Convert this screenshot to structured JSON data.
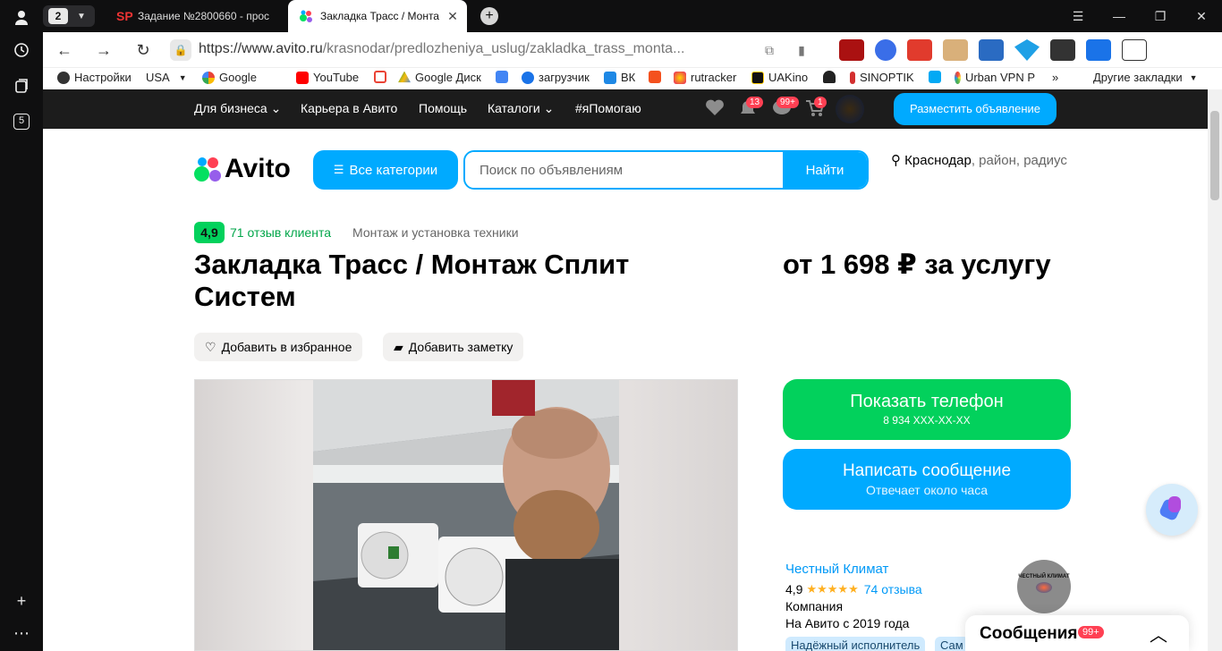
{
  "browser": {
    "tab_count": "2",
    "tabs": [
      {
        "title": "Задание №2800660 - прос"
      },
      {
        "title": "Закладка Трасс / Монта"
      }
    ],
    "url_host": "https://www.avito.ru",
    "url_path": "/krasnodar/predlozheniya_uslug/zakladka_trass_monta...",
    "leftbar_badge": "5"
  },
  "bookmarks": [
    {
      "label": "Настройки"
    },
    {
      "label": "USA"
    },
    {
      "label": "Google"
    },
    {
      "label": "YouTube"
    },
    {
      "label": "Google Диск"
    },
    {
      "label": "загрузчик"
    },
    {
      "label": "ВК"
    },
    {
      "label": "rutracker"
    },
    {
      "label": "UAKino"
    },
    {
      "label": "SINOPTIK"
    },
    {
      "label": "Urban VPN P"
    },
    {
      "label": "Другие закладки"
    }
  ],
  "avito_top": {
    "business": "Для бизнеса",
    "career": "Карьера в Авито",
    "help": "Помощь",
    "catalogs": "Каталоги",
    "help_tag": "#яПомогаю",
    "notif_count": "13",
    "msg_count": "99+",
    "cart_count": "1",
    "post_ad": "Разместить объявление"
  },
  "header": {
    "logo": "Avito",
    "all_categories": "Все категории",
    "search_placeholder": "Поиск по объявлениям",
    "search_button": "Найти",
    "location_city": "Краснодар",
    "location_rest": ", район, радиус"
  },
  "listing": {
    "rating": "4,9",
    "reviews": "71 отзыв клиента",
    "category": "Монтаж и установка техники",
    "title": "Закладка Трасс / Монтаж Сплит Систем",
    "price": "от 1 698 ₽ за услугу",
    "add_favorite": "Добавить в избранное",
    "add_note": "Добавить заметку",
    "show_phone": "Показать телефон",
    "phone_masked": "8 934 XXX-XX-XX",
    "write_message": "Написать сообщение",
    "reply_time": "Отвечает около часа"
  },
  "seller": {
    "name": "Честный Климат",
    "rating": "4,9",
    "stars": 5,
    "reviews": "74 отзыва",
    "type": "Компания",
    "since": "На Авито с 2019 года",
    "tags": [
      "Надёжный исполнитель",
      "Сам"
    ],
    "avatar_text": "ЧЕСТНЫЙ КЛИМАТ"
  },
  "messages_panel": {
    "title": "Сообщения",
    "badge": "99+"
  },
  "colors": {
    "avito_blue": "#00aaff",
    "avito_green": "#02d15c",
    "badge_red": "#ff4053"
  }
}
